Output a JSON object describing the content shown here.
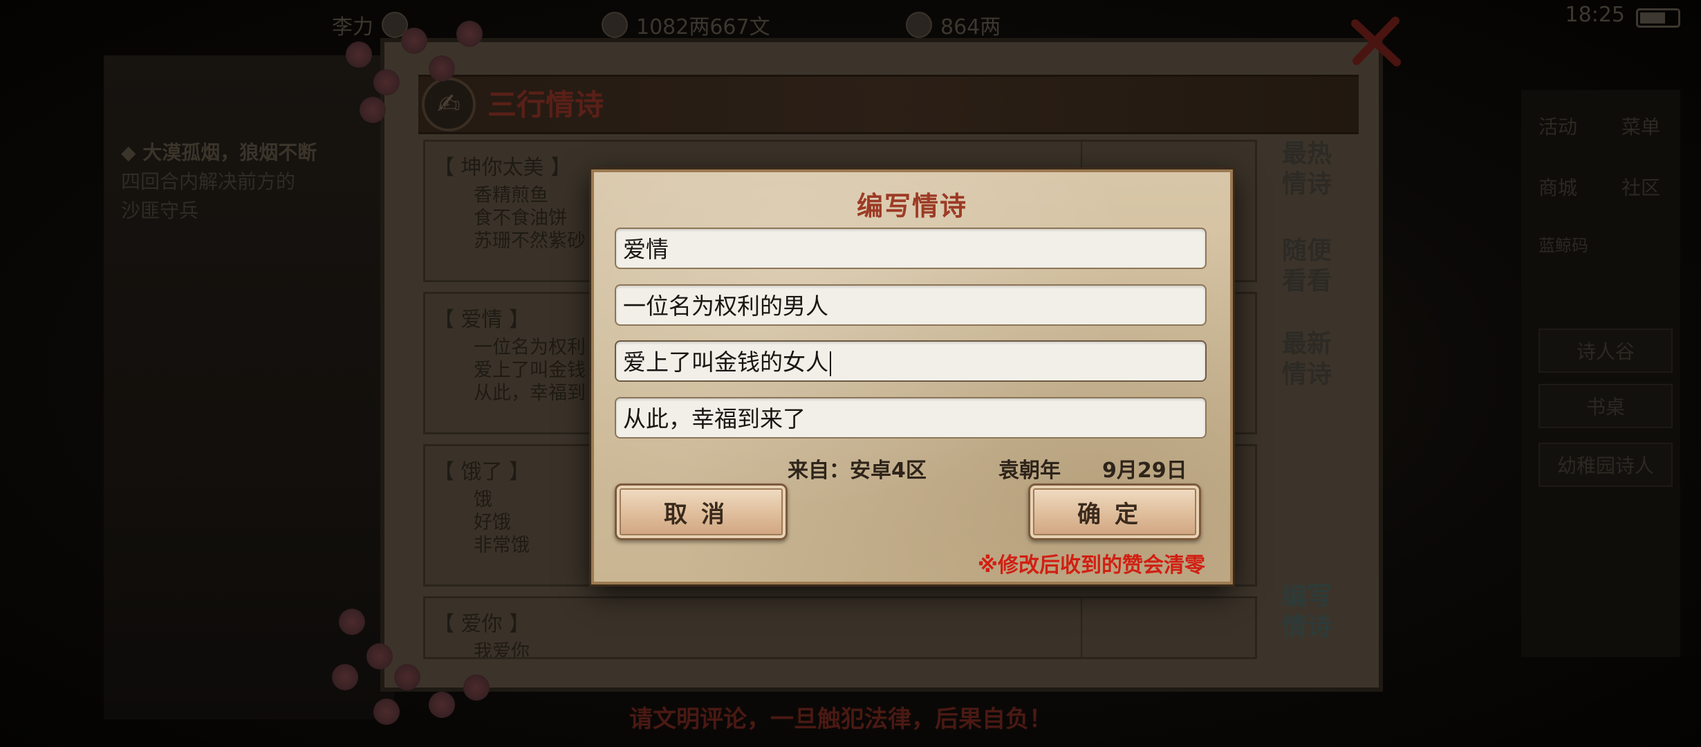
{
  "topbar": {
    "player_name": "李力",
    "resource_1": "1082两667文",
    "resource_2": "864两",
    "clock": "18:25"
  },
  "left_panel": {
    "line1": "◆ 大漠孤烟，狼烟不断",
    "line2": "四回合内解决前方的",
    "line3": "沙匪守兵"
  },
  "right_panel": {
    "item1": "活动",
    "item2": "菜单",
    "item3": "商城",
    "item4": "社区",
    "item5": "蓝鲸码",
    "btn1": "诗人谷",
    "btn2": "书桌",
    "btn3": "幼稚园诗人"
  },
  "panel": {
    "title": "三行情诗",
    "bottom_warning": "请文明评论，一旦触犯法律，后果自负！"
  },
  "poems": [
    {
      "title": "【 坤你太美 】",
      "lines": [
        "香精煎鱼",
        "食不食油饼",
        "苏珊不然紫砂"
      ]
    },
    {
      "title": "【 爱情 】",
      "lines": [
        "一位名为权利",
        "爱上了叫金钱",
        "从此，幸福到"
      ]
    },
    {
      "title": "【 饿了 】",
      "lines": [
        "饿",
        "好饿",
        "非常饿"
      ]
    },
    {
      "title": "【 爱你 】",
      "lines": [
        "我爱你"
      ]
    }
  ],
  "side_nav": {
    "hottest": "最热\n情诗",
    "random": "随便\n看看",
    "newest": "最新\n情诗",
    "write": "编写\n情诗"
  },
  "dialog": {
    "title": "编写情诗",
    "field_title": "爱情",
    "line1": "一位名为权利的男人",
    "line2": "爱上了叫金钱的女人",
    "line3": "从此，幸福到来了",
    "from": "来自：安卓4区",
    "author": "袁朝年",
    "date": "9月29日",
    "cancel": "取消",
    "confirm": "确定",
    "warning": "※修改后收到的赞会清零"
  }
}
